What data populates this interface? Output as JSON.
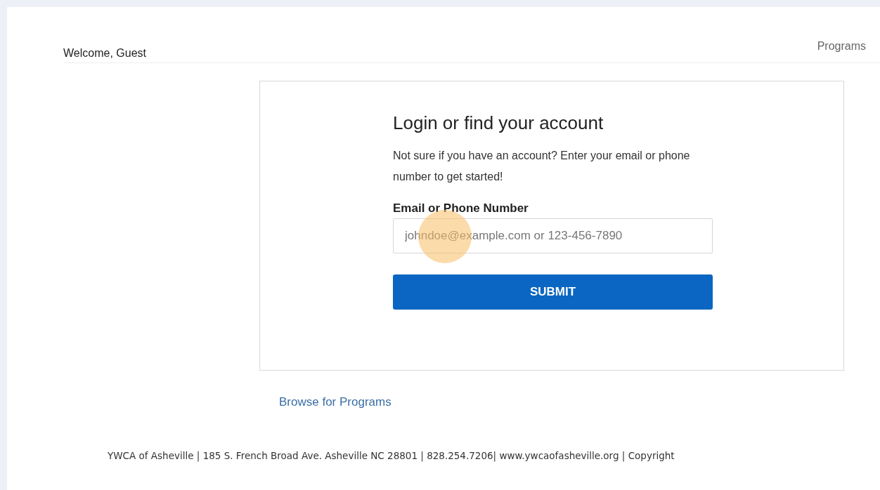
{
  "header": {
    "greeting": "Welcome, Guest",
    "nav_link": "Programs"
  },
  "login_card": {
    "title": "Login or find your account",
    "description": "Not sure if you have an account? Enter your email or phone number to get started!",
    "field_label": "Email or Phone Number",
    "field": {
      "placeholder": "johndoe@example.com or 123-456-7890"
    },
    "submit_button": "SUBMIT"
  },
  "browse_link": "Browse for Programs",
  "footer": "YWCA of Asheville | 185 S. French Broad Ave. Asheville NC 28801 | 828.254.7206| www.ywcaofasheville.org | Copyright"
}
